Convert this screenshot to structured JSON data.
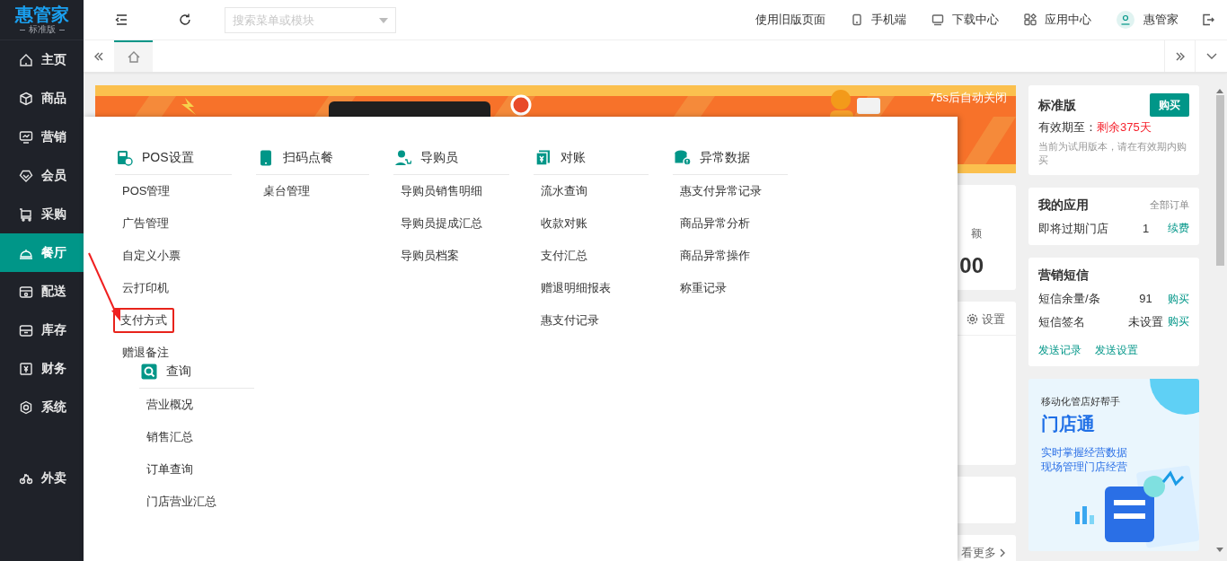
{
  "logo": {
    "name": "惠管家",
    "edition": "标准版"
  },
  "sidebar": {
    "items": [
      {
        "label": "主页",
        "selected": false
      },
      {
        "label": "商品",
        "selected": false
      },
      {
        "label": "营销",
        "selected": false
      },
      {
        "label": "会员",
        "selected": false
      },
      {
        "label": "采购",
        "selected": false
      },
      {
        "label": "餐厅",
        "selected": true
      },
      {
        "label": "配送",
        "selected": false
      },
      {
        "label": "库存",
        "selected": false
      },
      {
        "label": "财务",
        "selected": false
      },
      {
        "label": "系统",
        "selected": false
      }
    ],
    "extra_items": [
      {
        "label": "外卖",
        "selected": false
      }
    ]
  },
  "top_bar": {
    "search": {
      "placeholder": "搜索菜单或模块"
    },
    "links": [
      "使用旧版页面",
      "手机端",
      "下载中心",
      "应用中心"
    ],
    "user": "惠管家"
  },
  "tabs": [
    {
      "kind": "home",
      "selected": true
    }
  ],
  "banner": {
    "countdown": "75s后自动关闭"
  },
  "background_cards": {
    "amount_label": "额",
    "amount": "00",
    "settings": "设置",
    "more": "看更多"
  },
  "right_panel": {
    "plan": {
      "title": "标准版",
      "buy": "购买",
      "validity_label": "有效期至：",
      "validity_value": "剩余375天",
      "note": "当前为试用版本，请在有效期内购买"
    },
    "apps": {
      "title": "我的应用",
      "link": "全部订单",
      "rows": [
        {
          "label": "即将过期门店",
          "value": "1",
          "action": "续费"
        }
      ]
    },
    "sms": {
      "title": "营销短信",
      "rows": [
        {
          "label": "短信余量/条",
          "value": "91",
          "action": "购买"
        },
        {
          "label": "短信签名",
          "value": "未设置",
          "action": "购买"
        }
      ],
      "links": [
        "发送记录",
        "发送设置"
      ]
    },
    "promo": {
      "tagline": "移动化管店好帮手",
      "title": "门店通",
      "lines": [
        "实时掌握经营数据",
        "现场管理门店经营"
      ]
    }
  },
  "mega_menu": {
    "columns": [
      {
        "groups": [
          {
            "title": "POS设置",
            "items": [
              {
                "label": "POS管理",
                "highlighted": false
              },
              {
                "label": "广告管理",
                "highlighted": false
              },
              {
                "label": "自定义小票",
                "highlighted": false
              },
              {
                "label": "云打印机",
                "highlighted": false
              },
              {
                "label": "支付方式",
                "highlighted": true
              },
              {
                "label": "赠退备注",
                "highlighted": false
              }
            ]
          },
          {
            "title": "查询",
            "items": [
              {
                "label": "营业概况",
                "highlighted": false
              },
              {
                "label": "销售汇总",
                "highlighted": false
              },
              {
                "label": "订单查询",
                "highlighted": false
              },
              {
                "label": "门店营业汇总",
                "highlighted": false
              }
            ]
          }
        ]
      },
      {
        "groups": [
          {
            "title": "扫码点餐",
            "items": [
              {
                "label": "桌台管理",
                "highlighted": false
              }
            ]
          }
        ]
      },
      {
        "groups": [
          {
            "title": "导购员",
            "items": [
              {
                "label": "导购员销售明细",
                "highlighted": false
              },
              {
                "label": "导购员提成汇总",
                "highlighted": false
              },
              {
                "label": "导购员档案",
                "highlighted": false
              }
            ]
          }
        ]
      },
      {
        "groups": [
          {
            "title": "对账",
            "items": [
              {
                "label": "流水查询",
                "highlighted": false
              },
              {
                "label": "收款对账",
                "highlighted": false
              },
              {
                "label": "支付汇总",
                "highlighted": false
              },
              {
                "label": "赠退明细报表",
                "highlighted": false
              },
              {
                "label": "惠支付记录",
                "highlighted": false
              }
            ]
          }
        ]
      },
      {
        "groups": [
          {
            "title": "异常数据",
            "items": [
              {
                "label": "惠支付异常记录",
                "highlighted": false
              },
              {
                "label": "商品异常分析",
                "highlighted": false
              },
              {
                "label": "商品异常操作",
                "highlighted": false
              },
              {
                "label": "称重记录",
                "highlighted": false
              }
            ]
          }
        ]
      }
    ]
  }
}
